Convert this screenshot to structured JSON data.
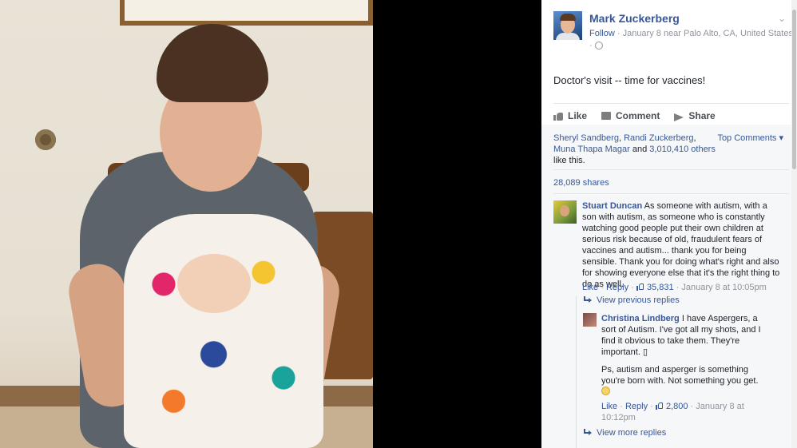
{
  "post": {
    "author": "Mark Zuckerberg",
    "follow": "Follow",
    "meta_sep": " · ",
    "date_location": "January 8 near Palo Alto, CA, United States",
    "privacy_sep": "·",
    "text": "Doctor's visit -- time for vaccines!"
  },
  "actions": {
    "like": "Like",
    "comment": "Comment",
    "share": "Share"
  },
  "reactions": {
    "liker1": "Sheryl Sandberg",
    "sep1": ", ",
    "liker2": "Randi Zuckerberg",
    "sep2": ",",
    "liker3": "Muna Thapa Magar",
    "and": " and ",
    "others": "3,010,410 others",
    "suffix": "like this.",
    "sort": "Top Comments ▾",
    "shares": "28,089 shares"
  },
  "comments": [
    {
      "name": "Stuart Duncan",
      "text": "As someone with autism, with a son with autism, as someone who is constantly watching good people put their own children at serious risk because of old, fraudulent fears of vaccines and autism... thank you for being sensible. Thank you for doing what's right and also for showing everyone else that it's the right thing to do as well.",
      "like": "Like",
      "reply": "Reply",
      "likes": "35,831",
      "time": "January 8 at 10:05pm"
    }
  ],
  "view_previous": "View previous replies",
  "reply": {
    "name": "Christina Lindberg",
    "text1": "I have Aspergers, a sort of Autism. I've got all my shots, and I find it obvious to take them. They're important. ▯",
    "text2": "Ps, autism and asperger is something you're born with. Not something you get.",
    "like": "Like",
    "reply": "Reply",
    "likes": "2,800",
    "time": "January 8 at 10:12pm"
  },
  "view_more": "View more replies",
  "dot": " · "
}
